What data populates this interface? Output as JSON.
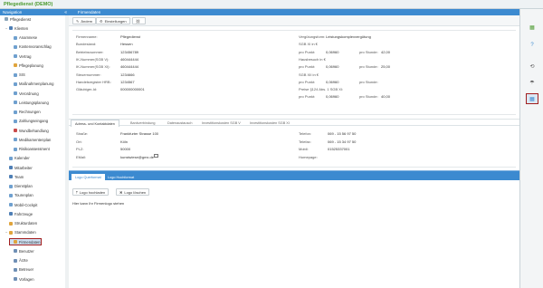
{
  "app": {
    "title": "Pflegedienst (DEMO)"
  },
  "sidebar": {
    "header": "Navigation",
    "collapse": "«",
    "items": [
      {
        "label": "Pflegedienst",
        "icon": "home-icon",
        "color": "#8aa4b8",
        "toggle": "",
        "indent": 0
      },
      {
        "label": "Klienten",
        "icon": "people-icon",
        "color": "#4f7fb5",
        "toggle": "−",
        "indent": 1
      },
      {
        "label": "Anamnese",
        "icon": "clipboard-icon",
        "color": "#6fa0cf",
        "toggle": "",
        "indent": 2
      },
      {
        "label": "Kostenvoranschlag",
        "icon": "calculator-icon",
        "color": "#6fa0cf",
        "toggle": "",
        "indent": 2
      },
      {
        "label": "Vertrag",
        "icon": "contract-icon",
        "color": "#6fa0cf",
        "toggle": "",
        "indent": 2
      },
      {
        "label": "Pflegeplanung",
        "icon": "plan-icon",
        "color": "#e0a43c",
        "toggle": "",
        "indent": 2
      },
      {
        "label": "SIS",
        "icon": "sis-icon",
        "color": "#6fa0cf",
        "toggle": "",
        "indent": 2
      },
      {
        "label": "Maßnahmenplanung",
        "icon": "measures-icon",
        "color": "#6fa0cf",
        "toggle": "",
        "indent": 2
      },
      {
        "label": "Verordnung",
        "icon": "prescription-icon",
        "color": "#6fa0cf",
        "toggle": "",
        "indent": 2
      },
      {
        "label": "Leistungsplanung",
        "icon": "service-plan-icon",
        "color": "#6fa0cf",
        "toggle": "",
        "indent": 2
      },
      {
        "label": "Rechnungen",
        "icon": "invoice-icon",
        "color": "#6fa0cf",
        "toggle": "",
        "indent": 2
      },
      {
        "label": "Zahlungseingang",
        "icon": "payment-icon",
        "color": "#6fa0cf",
        "toggle": "",
        "indent": 2
      },
      {
        "label": "Wundbehandlung",
        "icon": "bandage-icon",
        "color": "#c94b4b",
        "toggle": "",
        "indent": 2
      },
      {
        "label": "Medikamentenplan",
        "icon": "medication-icon",
        "color": "#6fa0cf",
        "toggle": "",
        "indent": 2
      },
      {
        "label": "Risikoassessment",
        "icon": "risk-icon",
        "color": "#6fa0cf",
        "toggle": "",
        "indent": 2
      },
      {
        "label": "Kalender",
        "icon": "calendar-icon",
        "color": "#6fa0cf",
        "toggle": "",
        "indent": 1
      },
      {
        "label": "Mitarbeiter",
        "icon": "employee-icon",
        "color": "#4f7fb5",
        "toggle": "",
        "indent": 1
      },
      {
        "label": "Team",
        "icon": "team-icon",
        "color": "#4f7fb5",
        "toggle": "",
        "indent": 1
      },
      {
        "label": "Dienstplan",
        "icon": "roster-icon",
        "color": "#6fa0cf",
        "toggle": "",
        "indent": 1
      },
      {
        "label": "Tourenplan",
        "icon": "route-icon",
        "color": "#6fa0cf",
        "toggle": "",
        "indent": 1
      },
      {
        "label": "Mobil-Cockpit",
        "icon": "mobile-icon",
        "color": "#6fa0cf",
        "toggle": "",
        "indent": 1
      },
      {
        "label": "Fahrzeuge",
        "icon": "car-icon",
        "color": "#4f7fb5",
        "toggle": "",
        "indent": 1
      },
      {
        "label": "Strukturdaten",
        "icon": "structure-icon",
        "color": "#e0a43c",
        "toggle": "",
        "indent": 1
      },
      {
        "label": "Stammdaten",
        "icon": "master-data-icon",
        "color": "#e0a43c",
        "toggle": "−",
        "indent": 1
      },
      {
        "label": "Firmendaten",
        "icon": "company-icon",
        "color": "#e0a43c",
        "toggle": "",
        "indent": 2,
        "selected": true
      },
      {
        "label": "Benutzer",
        "icon": "user-icon",
        "color": "#6f8fb5",
        "toggle": "",
        "indent": 2
      },
      {
        "label": "Ärzte",
        "icon": "doctor-icon",
        "color": "#6f8fb5",
        "toggle": "",
        "indent": 2
      },
      {
        "label": "Betreuer",
        "icon": "caregiver-icon",
        "color": "#6f8fb5",
        "toggle": "",
        "indent": 2
      },
      {
        "label": "Vorlagen",
        "icon": "template-icon",
        "color": "#6f8fb5",
        "toggle": "",
        "indent": 2
      }
    ]
  },
  "main": {
    "header": "Firmendaten",
    "toolbar": {
      "edit": "Ändern",
      "settings": "Einstellungen",
      "extra_icon": "link-icon"
    },
    "left_fields": [
      {
        "label": "Firmenname:",
        "value": "Pflegedienst"
      },
      {
        "label": "Bundesland:",
        "value": "Hessen"
      },
      {
        "label": "Betriebsnummer:",
        "value": "123456789"
      },
      {
        "label": "IK-Nummer(SGB V):",
        "value": "460444444"
      },
      {
        "label": "IK-Nummer(SGB XI):",
        "value": "460444444"
      },
      {
        "label": "Steuernummer:",
        "value": "1234666"
      },
      {
        "label": "Handelsregister HRB:",
        "value": "1234567"
      },
      {
        "label": "Gläubiger-Id:",
        "value": "000000000001"
      }
    ],
    "right_fields": [
      {
        "label": "Vergütungsform:",
        "value": "Leistungskomplexvergütung"
      },
      {
        "label": "SGB XI in €",
        "value": ""
      },
      {
        "label": "pro Punkt:",
        "value": "0,06960",
        "extra": "pro Stunde:",
        "extra_value": "42,00"
      },
      {
        "label": "Hausbesuch in €",
        "value": ""
      },
      {
        "label": "pro Punkt:",
        "value": "0,06960",
        "extra": "pro Stunde:",
        "extra_value": "25,00"
      },
      {
        "label": "SGB XII in €",
        "value": ""
      },
      {
        "label": "pro Punkt:",
        "value": "0,06960",
        "extra": "pro Stunde:",
        "extra_value": ""
      },
      {
        "label": "Preise §124 Abs. 1 SGB XI:",
        "value": ""
      },
      {
        "label": "pro Punkt:",
        "value": "0,06960",
        "extra": "pro Stunde:",
        "extra_value": "40,00"
      }
    ],
    "tabs": [
      "Adress- und Kontaktdaten",
      "Bankverbindung",
      "Datenaustausch",
      "Investitionskosten SGB V",
      "Investitionskosten SGB XI"
    ],
    "active_tab": 0,
    "address_left": [
      {
        "label": "Straße:",
        "value": "Frankfurter Strasse 100"
      },
      {
        "label": "Ort:",
        "value": "Köln"
      },
      {
        "label": "PLZ:",
        "value": "50000"
      },
      {
        "label": "EMail:",
        "value": "kunstwiese@gmx.de"
      }
    ],
    "address_right": [
      {
        "label": "Telefon:",
        "value": "069 - 15 56 97 50"
      },
      {
        "label": "Telefax:",
        "value": "069 - 15 34 97 50"
      },
      {
        "label": "Mobil:",
        "value": "01525337001"
      },
      {
        "label": "Homepage:",
        "value": ""
      }
    ],
    "logo_tabs": [
      "Logo Querformat",
      "Logo Hochformat"
    ],
    "logo_buttons": {
      "upload": "Logo hochladen",
      "delete": "Logo löschen"
    },
    "logo_hint": "Hier kann Ihr Firmenlogo stehen"
  },
  "rightbar": {
    "icons": [
      {
        "name": "company-icon",
        "glyph": "▦",
        "color": "#4b9a2f",
        "selected": false
      },
      {
        "name": "help-icon",
        "glyph": "?",
        "color": "#3c8ad0",
        "selected": false
      },
      {
        "name": "refresh-icon",
        "glyph": "⟲",
        "color": "#555555",
        "selected": false
      },
      {
        "name": "umbrella-icon",
        "glyph": "☂",
        "color": "#555555",
        "selected": false
      },
      {
        "name": "grid-view-icon",
        "glyph": "▦",
        "color": "#3c8ad0",
        "selected": true
      }
    ]
  }
}
